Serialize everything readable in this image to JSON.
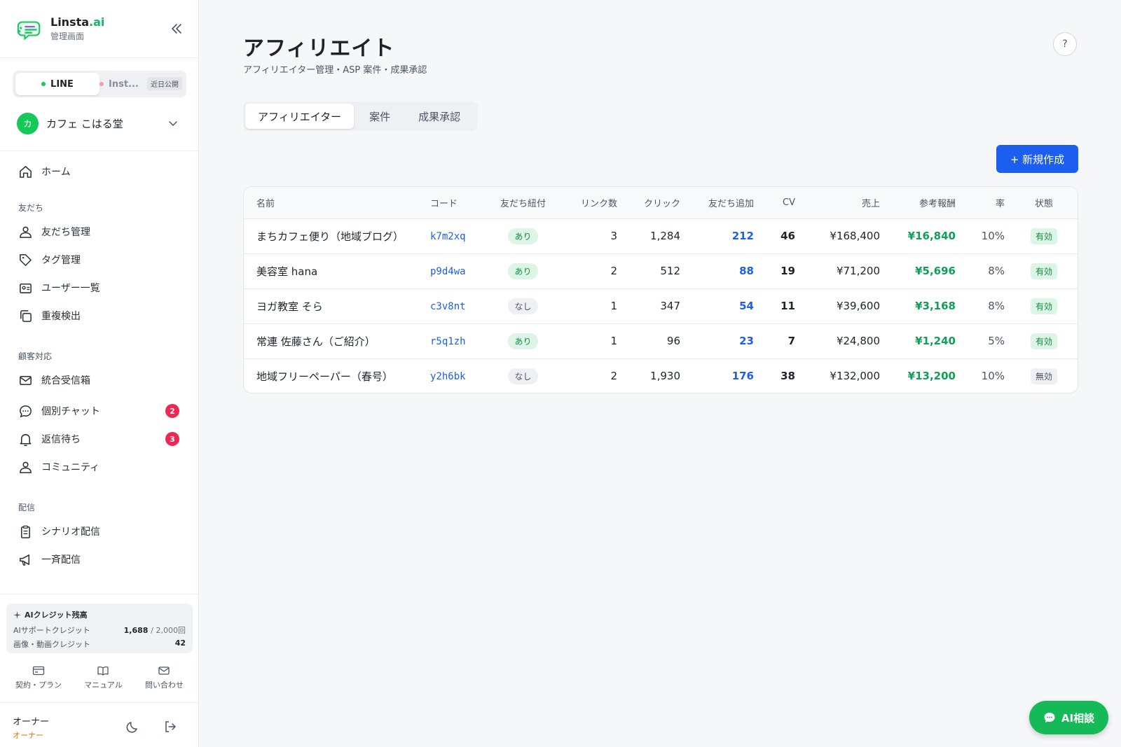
{
  "brand": {
    "name_main": "Linsta",
    "name_ai": ".ai",
    "subtitle": "管理画面"
  },
  "channels": {
    "line": "LINE",
    "instagram": "Inst...",
    "soon_badge": "近日公開"
  },
  "account": {
    "avatar": "カ",
    "name": "カフェ こはる堂"
  },
  "nav": {
    "home": "ホーム",
    "section_friends": "友だち",
    "friend_mgmt": "友だち管理",
    "tag_mgmt": "タグ管理",
    "user_list": "ユーザー一覧",
    "dup_detect": "重複検出",
    "section_support": "顧客対応",
    "inbox": "統合受信箱",
    "chat": "個別チャット",
    "chat_count": "2",
    "waiting": "返信待ち",
    "waiting_count": "3",
    "community": "コミュニティ",
    "section_delivery": "配信",
    "scenario": "シナリオ配信",
    "broadcast": "一斉配信"
  },
  "credits": {
    "title": "AIクレジット残高",
    "support_label": "AIサポートクレジット",
    "support_value": "1,688",
    "support_total": "/ 2,000回",
    "media_label": "画像・動画クレジット",
    "media_value": "42"
  },
  "footer_links": {
    "plan": "契約・プラン",
    "manual": "マニュアル",
    "contact": "問い合わせ"
  },
  "user": {
    "name": "オーナー",
    "role": "オーナー"
  },
  "page": {
    "title": "アフィリエイト",
    "subtitle": "アフィリエイター管理・ASP 案件・成果承認",
    "help": "?",
    "tabs": [
      "アフィリエイター",
      "案件",
      "成果承認"
    ],
    "new_button": "+ 新規作成"
  },
  "table": {
    "headers": [
      "名前",
      "コード",
      "友だち紐付",
      "リンク数",
      "クリック",
      "友だち追加",
      "CV",
      "売上",
      "参考報酬",
      "率",
      "状態"
    ],
    "rows": [
      {
        "name": "まちカフェ便り（地域ブログ）",
        "code": "k7m2xq",
        "linked": "あり",
        "links": "3",
        "clicks": "1,284",
        "friends": "212",
        "cv": "46",
        "sales": "¥168,400",
        "reward": "¥16,840",
        "rate": "10%",
        "status": "有効"
      },
      {
        "name": "美容室 hana",
        "code": "p9d4wa",
        "linked": "あり",
        "links": "2",
        "clicks": "512",
        "friends": "88",
        "cv": "19",
        "sales": "¥71,200",
        "reward": "¥5,696",
        "rate": "8%",
        "status": "有効"
      },
      {
        "name": "ヨガ教室 そら",
        "code": "c3v8nt",
        "linked": "なし",
        "links": "1",
        "clicks": "347",
        "friends": "54",
        "cv": "11",
        "sales": "¥39,600",
        "reward": "¥3,168",
        "rate": "8%",
        "status": "有効"
      },
      {
        "name": "常連 佐藤さん（ご紹介）",
        "code": "r5q1zh",
        "linked": "あり",
        "links": "1",
        "clicks": "96",
        "friends": "23",
        "cv": "7",
        "sales": "¥24,800",
        "reward": "¥1,240",
        "rate": "5%",
        "status": "有効"
      },
      {
        "name": "地域フリーペーパー（春号）",
        "code": "y2h6bk",
        "linked": "なし",
        "links": "2",
        "clicks": "1,930",
        "friends": "176",
        "cv": "38",
        "sales": "¥132,000",
        "reward": "¥13,200",
        "rate": "10%",
        "status": "無効"
      }
    ]
  },
  "ai_button": "AI相談",
  "colors": {
    "accent": "#1b5ef0",
    "line_green": "#16c75a",
    "reward_green": "#0f9f57",
    "badge_red": "#ef2754"
  }
}
